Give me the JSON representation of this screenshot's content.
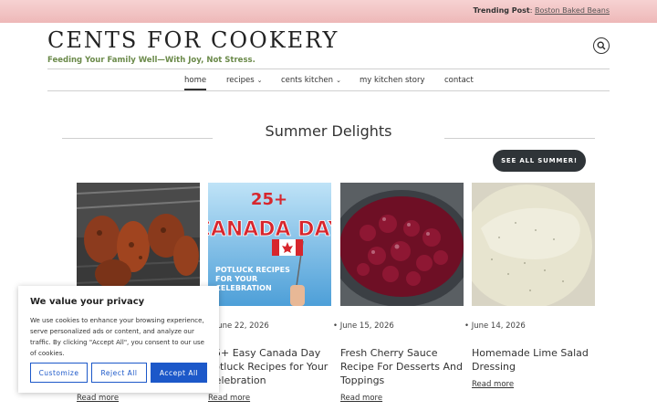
{
  "topbar": {
    "trending_label": "Trending Post",
    "trending_link": "Boston Baked Beans"
  },
  "site": {
    "title": "CENTS FOR COOKERY",
    "tagline": "Feeding Your Family Well—With Joy, Not Stress."
  },
  "nav": {
    "items": [
      {
        "label": "home",
        "active": true,
        "dropdown": false
      },
      {
        "label": "recipes",
        "active": false,
        "dropdown": true
      },
      {
        "label": "cents kitchen",
        "active": false,
        "dropdown": true
      },
      {
        "label": "my kitchen story",
        "active": false,
        "dropdown": false
      },
      {
        "label": "contact",
        "active": false,
        "dropdown": false
      }
    ]
  },
  "section": {
    "title": "Summer Delights",
    "see_all": "SEE ALL SUMMER!"
  },
  "cards": [
    {
      "date": "",
      "title": "",
      "more": "Read more"
    },
    {
      "date": "June 22, 2026",
      "title": "25+ Easy Canada Day Potluck Recipes for Your Celebration",
      "more": "Read more"
    },
    {
      "date": "June 15, 2026",
      "title": "Fresh Cherry Sauce Recipe For Desserts And Toppings",
      "more": "Read more"
    },
    {
      "date": "June 14, 2026",
      "title": "Homemade Lime Salad Dressing",
      "more": "Read more"
    }
  ],
  "poster": {
    "number": "25+",
    "headline": "CANADA DAY",
    "sub1": "POTLUCK RECIPES",
    "sub2": "FOR YOUR",
    "sub3": "CELEBRATION"
  },
  "cookie": {
    "title": "We value your privacy",
    "body": "We use cookies to enhance your browsing experience, serve personalized ads or content, and analyze our traffic. By clicking \"Accept All\", you consent to our use of cookies.",
    "customize": "Customize",
    "reject": "Reject All",
    "accept": "Accept All"
  },
  "colors": {
    "accent": "#1c58c9",
    "tagline": "#6b8a4a",
    "topbar": "#eeb8b8",
    "button_dark": "#2f3438"
  }
}
